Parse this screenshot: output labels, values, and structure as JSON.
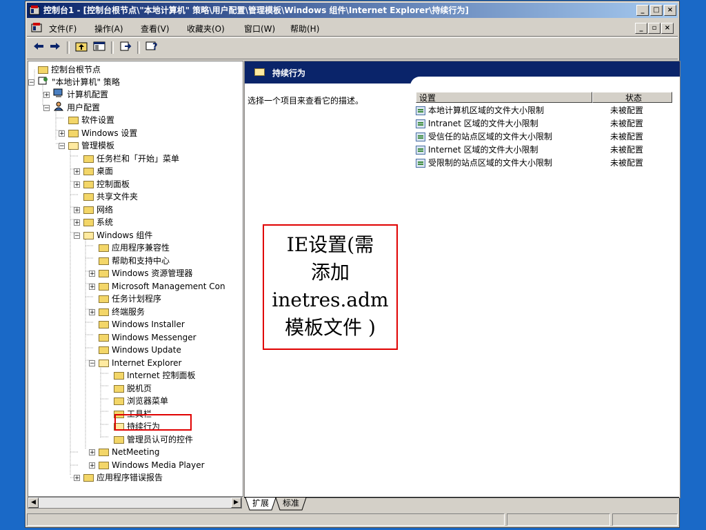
{
  "window": {
    "title": "控制台1 - [控制台根节点\\\"本地计算机\" 策略\\用户配置\\管理模板\\Windows 组件\\Internet Explorer\\持续行为]",
    "caption_buttons": [
      "_",
      "□",
      "×"
    ]
  },
  "menubar": {
    "items": [
      "文件(F)",
      "操作(A)",
      "查看(V)",
      "收藏夹(O)",
      "窗口(W)",
      "帮助(H)"
    ],
    "mdi_buttons": [
      "_",
      "▫",
      "×"
    ]
  },
  "toolbar": {
    "buttons": [
      "back-arrow-icon",
      "forward-arrow-icon",
      "up-folder-icon",
      "show-tree-icon",
      "export-list-icon",
      "help-icon"
    ]
  },
  "tree": {
    "items": [
      {
        "label": "控制台根节点"
      },
      {
        "label": "\"本地计算机\" 策略"
      },
      {
        "label": "计算机配置"
      },
      {
        "label": "用户配置"
      },
      {
        "label": "软件设置"
      },
      {
        "label": "Windows 设置"
      },
      {
        "label": "管理模板"
      },
      {
        "label": "任务栏和「开始」菜单"
      },
      {
        "label": "桌面"
      },
      {
        "label": "控制面板"
      },
      {
        "label": "共享文件夹"
      },
      {
        "label": "网络"
      },
      {
        "label": "系统"
      },
      {
        "label": "Windows 组件"
      },
      {
        "label": "应用程序兼容性"
      },
      {
        "label": "帮助和支持中心"
      },
      {
        "label": "Windows 资源管理器"
      },
      {
        "label": "Microsoft Management Con"
      },
      {
        "label": "任务计划程序"
      },
      {
        "label": "终端服务"
      },
      {
        "label": "Windows Installer"
      },
      {
        "label": "Windows Messenger"
      },
      {
        "label": "Windows Update"
      },
      {
        "label": "Internet Explorer"
      },
      {
        "label": "Internet 控制面板"
      },
      {
        "label": "脱机页"
      },
      {
        "label": "浏览器菜单"
      },
      {
        "label": "工具栏"
      },
      {
        "label": "持续行为"
      },
      {
        "label": "管理员认可的控件"
      },
      {
        "label": "NetMeeting"
      },
      {
        "label": "Windows Media Player"
      },
      {
        "label": "应用程序错误报告"
      }
    ]
  },
  "details": {
    "header_title": "持续行为",
    "description": "选择一个项目来查看它的描述。",
    "columns": [
      "设置",
      "状态"
    ],
    "rows": [
      {
        "name": "本地计算机区域的文件大小限制",
        "state": "未被配置"
      },
      {
        "name": "Intranet 区域的文件大小限制",
        "state": "未被配置"
      },
      {
        "name": "受信任的站点区域的文件大小限制",
        "state": "未被配置"
      },
      {
        "name": "Internet 区域的文件大小限制",
        "state": "未被配置"
      },
      {
        "name": "受限制的站点区域的文件大小限制",
        "state": "未被配置"
      }
    ],
    "tabs": [
      "扩展",
      "标准"
    ]
  },
  "annotation": {
    "lines": [
      "IE设置(需",
      "添加",
      "inetres.adm",
      "模板文件 )"
    ],
    "border_color": "#e00000"
  }
}
